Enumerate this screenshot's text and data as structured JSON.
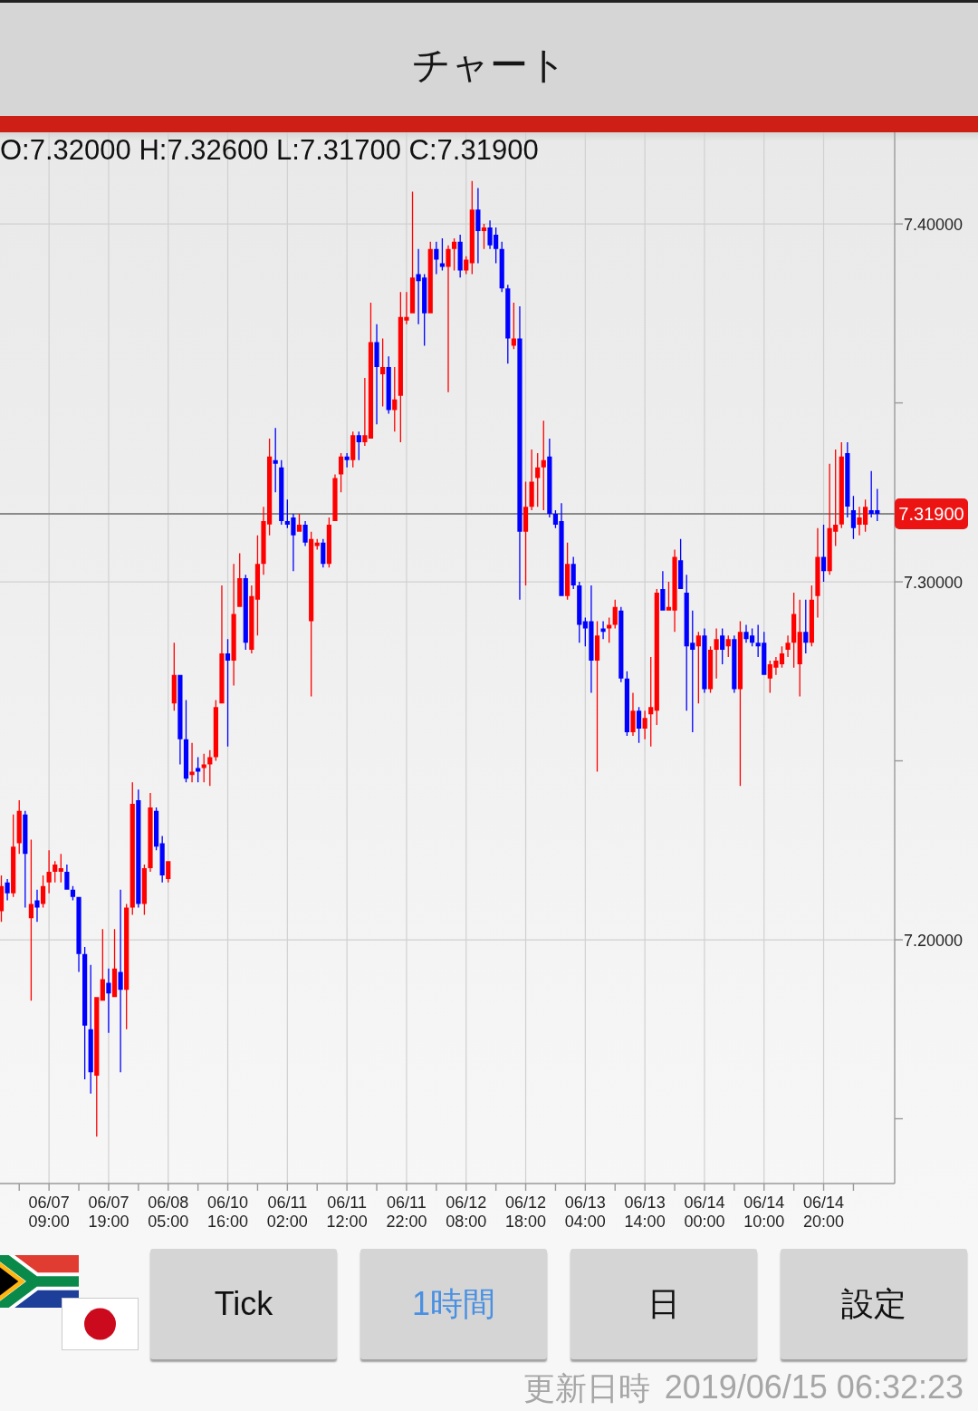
{
  "header": {
    "title": "チャート"
  },
  "chart": {
    "ohlc_readout": "O:7.32000 H:7.32600 L:7.31700 C:7.31900",
    "chart_data": {
      "type": "candlestick",
      "grid": true,
      "categories": [
        null,
        null,
        null,
        null,
        null,
        null,
        null,
        null,
        "06/07 09:00",
        null,
        null,
        null,
        null,
        null,
        null,
        null,
        null,
        null,
        "06/07 19:00",
        null,
        null,
        null,
        null,
        null,
        null,
        null,
        null,
        null,
        "06/08 05:00",
        null,
        null,
        null,
        null,
        null,
        null,
        null,
        null,
        null,
        "06/10 16:00",
        null,
        null,
        null,
        null,
        null,
        null,
        null,
        null,
        null,
        "06/11 02:00",
        null,
        null,
        null,
        null,
        null,
        null,
        null,
        null,
        null,
        "06/11 12:00",
        null,
        null,
        null,
        null,
        null,
        null,
        null,
        null,
        null,
        "06/11 22:00",
        null,
        null,
        null,
        null,
        null,
        null,
        null,
        null,
        null,
        "06/12 08:00",
        null,
        null,
        null,
        null,
        null,
        null,
        null,
        null,
        null,
        "06/12 18:00",
        null,
        null,
        null,
        null,
        null,
        null,
        null,
        null,
        null,
        "06/13 04:00",
        null,
        null,
        null,
        null,
        null,
        null,
        null,
        null,
        null,
        "06/13 14:00",
        null,
        null,
        null,
        null,
        null,
        null,
        null,
        null,
        null,
        "06/14 00:00",
        null,
        null,
        null,
        null,
        null,
        null,
        null,
        null,
        null,
        "06/14 10:00",
        null,
        null,
        null,
        null,
        null,
        null,
        null,
        null,
        null,
        "06/14 20:00",
        null,
        null,
        null,
        null,
        null,
        null,
        null,
        null,
        null
      ],
      "ohlc": [
        [
          7.208,
          7.218,
          7.205,
          7.215
        ],
        [
          7.216,
          7.217,
          7.211,
          7.213
        ],
        [
          7.213,
          7.235,
          7.212,
          7.226
        ],
        [
          7.227,
          7.239,
          7.224,
          7.236
        ],
        [
          7.235,
          7.236,
          7.209,
          7.224
        ],
        [
          7.206,
          7.228,
          7.183,
          7.21
        ],
        [
          7.211,
          7.214,
          7.205,
          7.209
        ],
        [
          7.21,
          7.218,
          7.209,
          7.215
        ],
        [
          7.216,
          7.225,
          7.213,
          7.219
        ],
        [
          7.219,
          7.222,
          7.216,
          7.221
        ],
        [
          7.219,
          7.224,
          7.216,
          7.22
        ],
        [
          7.219,
          7.221,
          7.214,
          7.214
        ],
        [
          7.214,
          7.215,
          7.211,
          7.212
        ],
        [
          7.212,
          7.212,
          7.191,
          7.196
        ],
        [
          7.196,
          7.198,
          7.161,
          7.176
        ],
        [
          7.175,
          7.193,
          7.157,
          7.163
        ],
        [
          7.162,
          7.184,
          7.145,
          7.184
        ],
        [
          7.183,
          7.203,
          7.183,
          7.189
        ],
        [
          7.188,
          7.192,
          7.174,
          7.185
        ],
        [
          7.184,
          7.203,
          7.184,
          7.192
        ],
        [
          7.191,
          7.214,
          7.163,
          7.186
        ],
        [
          7.186,
          7.21,
          7.175,
          7.209
        ],
        [
          7.209,
          7.244,
          7.207,
          7.238
        ],
        [
          7.239,
          7.242,
          7.209,
          7.21
        ],
        [
          7.21,
          7.221,
          7.207,
          7.22
        ],
        [
          7.22,
          7.241,
          7.219,
          7.237
        ],
        [
          7.236,
          7.237,
          7.225,
          7.226
        ],
        [
          7.227,
          7.229,
          7.216,
          7.218
        ],
        [
          7.217,
          7.222,
          7.216,
          7.222
        ],
        [
          7.266,
          7.283,
          7.264,
          7.274
        ],
        [
          7.274,
          7.274,
          7.249,
          7.256
        ],
        [
          7.256,
          7.267,
          7.244,
          7.245
        ],
        [
          7.246,
          7.255,
          7.244,
          7.247
        ],
        [
          7.248,
          7.251,
          7.244,
          7.247
        ],
        [
          7.248,
          7.252,
          7.244,
          7.249
        ],
        [
          7.249,
          7.253,
          7.243,
          7.251
        ],
        [
          7.251,
          7.267,
          7.25,
          7.265
        ],
        [
          7.266,
          7.299,
          7.266,
          7.28
        ],
        [
          7.28,
          7.284,
          7.254,
          7.278
        ],
        [
          7.278,
          7.305,
          7.271,
          7.291
        ],
        [
          7.293,
          7.308,
          7.293,
          7.301
        ],
        [
          7.301,
          7.302,
          7.281,
          7.283
        ],
        [
          7.281,
          7.299,
          7.28,
          7.296
        ],
        [
          7.295,
          7.313,
          7.285,
          7.305
        ],
        [
          7.305,
          7.321,
          7.302,
          7.317
        ],
        [
          7.316,
          7.34,
          7.313,
          7.335
        ],
        [
          7.334,
          7.343,
          7.325,
          7.333
        ],
        [
          7.332,
          7.334,
          7.316,
          7.317
        ],
        [
          7.317,
          7.323,
          7.315,
          7.316
        ],
        [
          7.318,
          7.319,
          7.303,
          7.313
        ],
        [
          7.314,
          7.319,
          7.314,
          7.316
        ],
        [
          7.316,
          7.317,
          7.31,
          7.311
        ],
        [
          7.289,
          7.314,
          7.268,
          7.312
        ],
        [
          7.31,
          7.312,
          7.309,
          7.311
        ],
        [
          7.311,
          7.312,
          7.304,
          7.305
        ],
        [
          7.305,
          7.318,
          7.304,
          7.316
        ],
        [
          7.317,
          7.33,
          7.317,
          7.329
        ],
        [
          7.33,
          7.336,
          7.325,
          7.335
        ],
        [
          7.335,
          7.336,
          7.332,
          7.334
        ],
        [
          7.334,
          7.342,
          7.332,
          7.341
        ],
        [
          7.341,
          7.342,
          7.334,
          7.339
        ],
        [
          7.339,
          7.357,
          7.338,
          7.341
        ],
        [
          7.34,
          7.378,
          7.34,
          7.367
        ],
        [
          7.367,
          7.372,
          7.344,
          7.36
        ],
        [
          7.358,
          7.368,
          7.349,
          7.36
        ],
        [
          7.36,
          7.363,
          7.347,
          7.348
        ],
        [
          7.348,
          7.36,
          7.342,
          7.351
        ],
        [
          7.352,
          7.381,
          7.339,
          7.374
        ],
        [
          7.373,
          7.381,
          7.372,
          7.374
        ],
        [
          7.375,
          7.409,
          7.375,
          7.385
        ],
        [
          7.386,
          7.393,
          7.372,
          7.384
        ],
        [
          7.385,
          7.386,
          7.366,
          7.375
        ],
        [
          7.375,
          7.395,
          7.375,
          7.393
        ],
        [
          7.393,
          7.395,
          7.386,
          7.39
        ],
        [
          7.389,
          7.396,
          7.387,
          7.388
        ],
        [
          7.388,
          7.394,
          7.353,
          7.393
        ],
        [
          7.393,
          7.396,
          7.387,
          7.395
        ],
        [
          7.395,
          7.397,
          7.385,
          7.387
        ],
        [
          7.387,
          7.391,
          7.386,
          7.39
        ],
        [
          7.389,
          7.412,
          7.386,
          7.404
        ],
        [
          7.404,
          7.41,
          7.389,
          7.398
        ],
        [
          7.398,
          7.4,
          7.393,
          7.399
        ],
        [
          7.399,
          7.401,
          7.393,
          7.394
        ],
        [
          7.397,
          7.399,
          7.389,
          7.393
        ],
        [
          7.393,
          7.395,
          7.381,
          7.382
        ],
        [
          7.382,
          7.383,
          7.361,
          7.368
        ],
        [
          7.366,
          7.378,
          7.365,
          7.368
        ],
        [
          7.368,
          7.377,
          7.295,
          7.314
        ],
        [
          7.314,
          7.328,
          7.299,
          7.321
        ],
        [
          7.321,
          7.337,
          7.32,
          7.328
        ],
        [
          7.329,
          7.336,
          7.321,
          7.332
        ],
        [
          7.332,
          7.345,
          7.32,
          7.334
        ],
        [
          7.335,
          7.34,
          7.318,
          7.319
        ],
        [
          7.319,
          7.32,
          7.315,
          7.316
        ],
        [
          7.317,
          7.322,
          7.296,
          7.296
        ],
        [
          7.296,
          7.311,
          7.295,
          7.305
        ],
        [
          7.305,
          7.307,
          7.298,
          7.299
        ],
        [
          7.299,
          7.3,
          7.283,
          7.288
        ],
        [
          7.289,
          7.29,
          7.282,
          7.287
        ],
        [
          7.289,
          7.299,
          7.269,
          7.278
        ],
        [
          7.278,
          7.289,
          7.247,
          7.285
        ],
        [
          7.287,
          7.289,
          7.284,
          7.286
        ],
        [
          7.287,
          7.29,
          7.283,
          7.288
        ],
        [
          7.288,
          7.295,
          7.287,
          7.293
        ],
        [
          7.292,
          7.293,
          7.272,
          7.273
        ],
        [
          7.273,
          7.275,
          7.257,
          7.258
        ],
        [
          7.258,
          7.269,
          7.257,
          7.264
        ],
        [
          7.264,
          7.265,
          7.255,
          7.259
        ],
        [
          7.259,
          7.264,
          7.256,
          7.262
        ],
        [
          7.263,
          7.279,
          7.254,
          7.265
        ],
        [
          7.264,
          7.298,
          7.26,
          7.297
        ],
        [
          7.298,
          7.303,
          7.292,
          7.292
        ],
        [
          7.292,
          7.3,
          7.292,
          7.293
        ],
        [
          7.292,
          7.309,
          7.286,
          7.307
        ],
        [
          7.306,
          7.312,
          7.298,
          7.298
        ],
        [
          7.297,
          7.302,
          7.264,
          7.282
        ],
        [
          7.283,
          7.292,
          7.258,
          7.281
        ],
        [
          7.282,
          7.286,
          7.266,
          7.285
        ],
        [
          7.285,
          7.287,
          7.269,
          7.27
        ],
        [
          7.27,
          7.282,
          7.269,
          7.281
        ],
        [
          7.281,
          7.287,
          7.273,
          7.284
        ],
        [
          7.285,
          7.287,
          7.277,
          7.281
        ],
        [
          7.282,
          7.285,
          7.279,
          7.284
        ],
        [
          7.284,
          7.285,
          7.269,
          7.27
        ],
        [
          7.27,
          7.289,
          7.243,
          7.286
        ],
        [
          7.286,
          7.288,
          7.283,
          7.284
        ],
        [
          7.285,
          7.287,
          7.282,
          7.283
        ],
        [
          7.283,
          7.288,
          7.279,
          7.282
        ],
        [
          7.283,
          7.286,
          7.274,
          7.274
        ],
        [
          7.273,
          7.278,
          7.269,
          7.277
        ],
        [
          7.276,
          7.279,
          7.274,
          7.278
        ],
        [
          7.277,
          7.282,
          7.276,
          7.28
        ],
        [
          7.281,
          7.285,
          7.279,
          7.283
        ],
        [
          7.283,
          7.297,
          7.276,
          7.291
        ],
        [
          7.277,
          7.295,
          7.268,
          7.286
        ],
        [
          7.286,
          7.295,
          7.28,
          7.283
        ],
        [
          7.283,
          7.299,
          7.282,
          7.295
        ],
        [
          7.296,
          7.315,
          7.29,
          7.307
        ],
        [
          7.307,
          7.316,
          7.3,
          7.303
        ],
        [
          7.303,
          7.333,
          7.302,
          7.315
        ],
        [
          7.314,
          7.337,
          7.31,
          7.316
        ],
        [
          7.316,
          7.339,
          7.315,
          7.335
        ],
        [
          7.336,
          7.339,
          7.318,
          7.321
        ],
        [
          7.32,
          7.324,
          7.312,
          7.315
        ],
        [
          7.316,
          7.321,
          7.313,
          7.318
        ],
        [
          7.316,
          7.323,
          7.314,
          7.321
        ],
        [
          7.32,
          7.331,
          7.318,
          7.319
        ],
        [
          7.32,
          7.326,
          7.317,
          7.319
        ]
      ],
      "ylim": [
        7.1319,
        7.4256
      ],
      "yticks": [
        {
          "value": 7.2,
          "label": "7.20000"
        },
        {
          "value": 7.3,
          "label": "7.30000"
        },
        {
          "value": 7.4,
          "label": "7.40000"
        }
      ],
      "ref_lines": [
        {
          "axis": "y",
          "value": 7.319,
          "label": "7.31900"
        }
      ]
    }
  },
  "period_tabs": [
    {
      "label": "Tick",
      "selected": false
    },
    {
      "label": "1時間",
      "selected": true
    },
    {
      "label": "日",
      "selected": false
    }
  ],
  "settings_button": {
    "label": "設定"
  },
  "last_updated": {
    "label": "更新日時",
    "value": "2019/06/15 06:32:23"
  }
}
